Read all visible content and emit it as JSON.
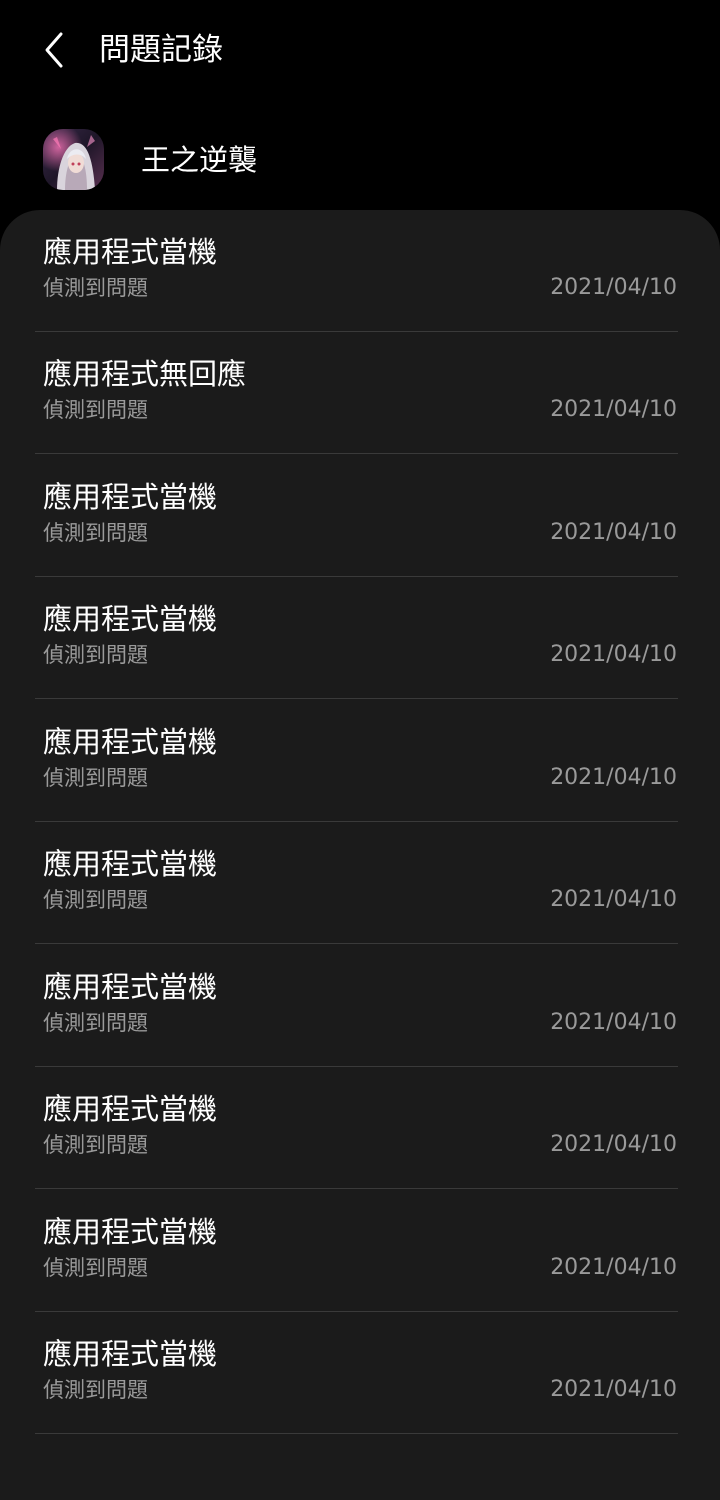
{
  "header": {
    "title": "問題記錄",
    "back_icon": "chevron-left-icon"
  },
  "app": {
    "name": "王之逆襲",
    "icon": "app-avatar-icon"
  },
  "items": [
    {
      "title": "應用程式當機",
      "subtitle": "偵測到問題",
      "date": "2021/04/10"
    },
    {
      "title": "應用程式無回應",
      "subtitle": "偵測到問題",
      "date": "2021/04/10"
    },
    {
      "title": "應用程式當機",
      "subtitle": "偵測到問題",
      "date": "2021/04/10"
    },
    {
      "title": "應用程式當機",
      "subtitle": "偵測到問題",
      "date": "2021/04/10"
    },
    {
      "title": "應用程式當機",
      "subtitle": "偵測到問題",
      "date": "2021/04/10"
    },
    {
      "title": "應用程式當機",
      "subtitle": "偵測到問題",
      "date": "2021/04/10"
    },
    {
      "title": "應用程式當機",
      "subtitle": "偵測到問題",
      "date": "2021/04/10"
    },
    {
      "title": "應用程式當機",
      "subtitle": "偵測到問題",
      "date": "2021/04/10"
    },
    {
      "title": "應用程式當機",
      "subtitle": "偵測到問題",
      "date": "2021/04/10"
    },
    {
      "title": "應用程式當機",
      "subtitle": "偵測到問題",
      "date": "2021/04/10"
    }
  ],
  "colors": {
    "background": "#000000",
    "card": "#1b1b1b",
    "text_primary": "#ffffff",
    "text_secondary": "#9a9a9a",
    "divider": "#3a3a3a"
  }
}
